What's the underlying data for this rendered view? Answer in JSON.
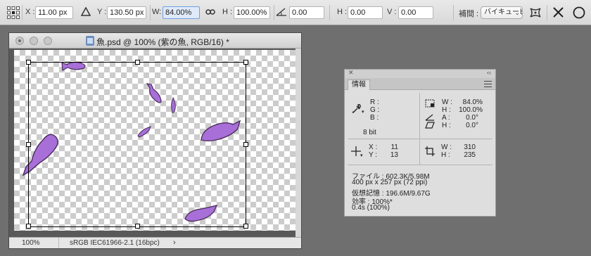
{
  "options_bar": {
    "x_label": "X :",
    "x_value": "11.00 px",
    "y_label": "Y :",
    "y_value": "130.50 px",
    "w_label": "W:",
    "w_value": "84.00%",
    "h_label": "H :",
    "h_value": "100.00%",
    "angle_value": "0.00",
    "skew_h_label": "H :",
    "skew_h_value": "0.00",
    "skew_v_label": "V :",
    "skew_v_value": "0.00",
    "interpolation_label": "補間 :",
    "interpolation_value": "バイキュービッ…",
    "icons": [
      "reference-point-grid-icon",
      "delta-icon",
      "link-icon",
      "angle-icon",
      "warp-icon",
      "cancel-icon",
      "commit-icon"
    ]
  },
  "document": {
    "title": "魚.psd @ 100% (紫の魚, RGB/16) *",
    "zoom": "100%",
    "profile": "sRGB IEC61966-2.1 (16bpc)",
    "more_arrow": "›"
  },
  "info_panel": {
    "close": "✕",
    "collapse": "‹‹",
    "tab": "情報",
    "rgb": {
      "r_label": "R :",
      "g_label": "G :",
      "b_label": "B :"
    },
    "bit_depth": "8 bit",
    "transform": {
      "w_label": "W :",
      "w_value": "84.0%",
      "h_label": "H :",
      "h_value": "100.0%",
      "a_label": "A :",
      "a_value": "0.0°",
      "hs_label": "H :",
      "hs_value": "0.0°"
    },
    "position": {
      "x_label": "X :",
      "x_value": "11",
      "y_label": "Y :",
      "y_value": "13"
    },
    "size": {
      "w_label": "W :",
      "w_value": "310",
      "h_label": "H :",
      "h_value": "235"
    },
    "status_lines": [
      "ファイル : 602.3K/5.98M",
      "400 px x 257 px (72 ppi)",
      "仮想記憶 : 196.6M/9.67G",
      "効率 : 100%*",
      "0.4s (100%)"
    ]
  },
  "colors": {
    "fish": "#a86fd8",
    "fish_dark": "#4a2d5c",
    "field_active": "#dfe9f8"
  }
}
